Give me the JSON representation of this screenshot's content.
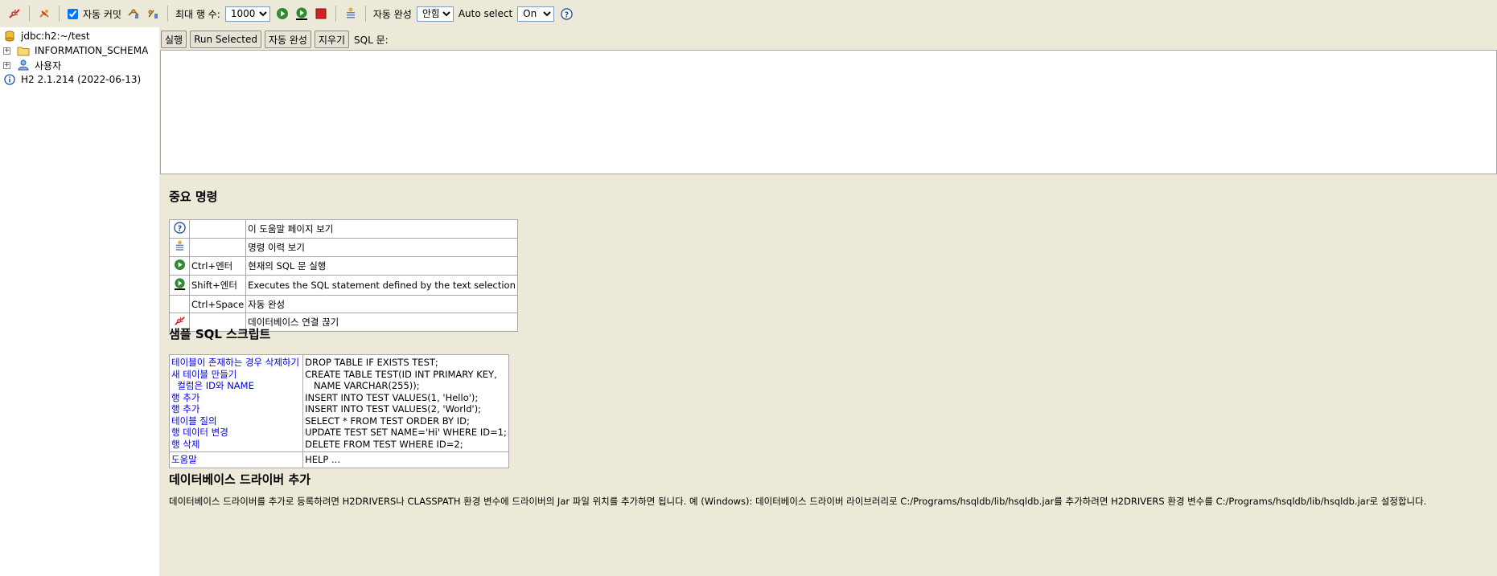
{
  "toolbar": {
    "auto_commit_label": "자동 커밋",
    "max_rows_label": "최대 행 수:",
    "max_rows_value": "1000",
    "auto_complete_label": "자동 완성",
    "auto_complete_value": "안함",
    "auto_select_label": "Auto select",
    "auto_select_value": "On",
    "icons": [
      "disconnect-icon",
      "refresh-icon",
      "auto-commit-checkbox",
      "rollback-icon",
      "commit-icon",
      "run-icon",
      "run-selected-icon",
      "stop-icon",
      "history-icon",
      "help-icon"
    ]
  },
  "tree": {
    "connection": "jdbc:h2:~/test",
    "schema": "INFORMATION_SCHEMA",
    "users": "사용자",
    "version": "H2 2.1.214 (2022-06-13)"
  },
  "buttons": {
    "run": "실행",
    "run_selected": "Run Selected",
    "auto_complete": "자동 완성",
    "clear": "지우기",
    "sql_label": "SQL 문:"
  },
  "help": {
    "title": "중요 명령",
    "rows": [
      {
        "icon": "help-icon",
        "key": "",
        "desc": "이 도움말 페이지 보기"
      },
      {
        "icon": "history-icon",
        "key": "",
        "desc": "명령 이력 보기"
      },
      {
        "icon": "run-icon",
        "key": "Ctrl+엔터",
        "desc": "현재의 SQL 문 실행"
      },
      {
        "icon": "run-selected-icon",
        "key": "Shift+엔터",
        "desc": "Executes the SQL statement defined by the text selection"
      },
      {
        "icon": "",
        "key": "Ctrl+Space",
        "desc": "자동 완성"
      },
      {
        "icon": "disconnect-icon",
        "key": "",
        "desc": "데이터베이스 연결 끊기"
      }
    ]
  },
  "samples": {
    "title": "샘플 SQL 스크립트",
    "links": [
      "테이블이 존재하는 경우 삭제하기",
      "새 테이블 만들기",
      "  컬럼은 ID와 NAME",
      "행 추가",
      "행 추가",
      "테이블 질의",
      "행 데이터 변경",
      "행 삭제"
    ],
    "sql": [
      "DROP TABLE IF EXISTS TEST;",
      "CREATE TABLE TEST(ID INT PRIMARY KEY,",
      "   NAME VARCHAR(255));",
      "INSERT INTO TEST VALUES(1, 'Hello');",
      "INSERT INTO TEST VALUES(2, 'World');",
      "SELECT * FROM TEST ORDER BY ID;",
      "UPDATE TEST SET NAME='Hi' WHERE ID=1;",
      "DELETE FROM TEST WHERE ID=2;"
    ],
    "help_link": "도움말",
    "help_sql": "HELP ..."
  },
  "drivers": {
    "title": "데이터베이스 드라이버 추가",
    "text": "데이터베이스 드라이버를 추가로 등록하려면 H2DRIVERS나 CLASSPATH 환경 변수에 드라이버의 Jar 파일 위치를 추가하면 됩니다. 예 (Windows): 데이터베이스 드라이버 라이브러리로 C:/Programs/hsqldb/lib/hsqldb.jar를 추가하려면 H2DRIVERS 환경 변수를 C:/Programs/hsqldb/lib/hsqldb.jar로 설정합니다."
  },
  "colors": {
    "background": "#ece9d8",
    "link": "#0000ee",
    "run": "#2e8b2e",
    "stop": "#d42020",
    "disconnect": "#c83030"
  }
}
